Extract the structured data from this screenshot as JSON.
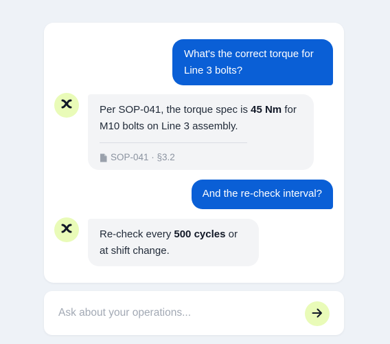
{
  "messages": [
    {
      "role": "user",
      "text": "What's the correct torque for Line 3 bolts?"
    },
    {
      "role": "assistant",
      "text_before": "Per SOP-041, the torque spec is ",
      "bold": "45 Nm",
      "text_after": " for M10 bolts on Line 3 assembly.",
      "source": {
        "icon": "document-icon",
        "label": "SOP-041 · §3.2"
      }
    },
    {
      "role": "user",
      "text": "And the re-check interval?"
    },
    {
      "role": "assistant",
      "text_before": "Re-check every ",
      "bold": "500 cycles",
      "text_after": " or at shift change."
    }
  ],
  "composer": {
    "placeholder": "Ask about your operations...",
    "send_icon": "arrow-right-icon"
  },
  "colors": {
    "accent": "#0a5fd6",
    "avatar_bg": "#e9fbb8",
    "bot_bubble": "#f3f4f6",
    "background": "#eef2f7"
  }
}
